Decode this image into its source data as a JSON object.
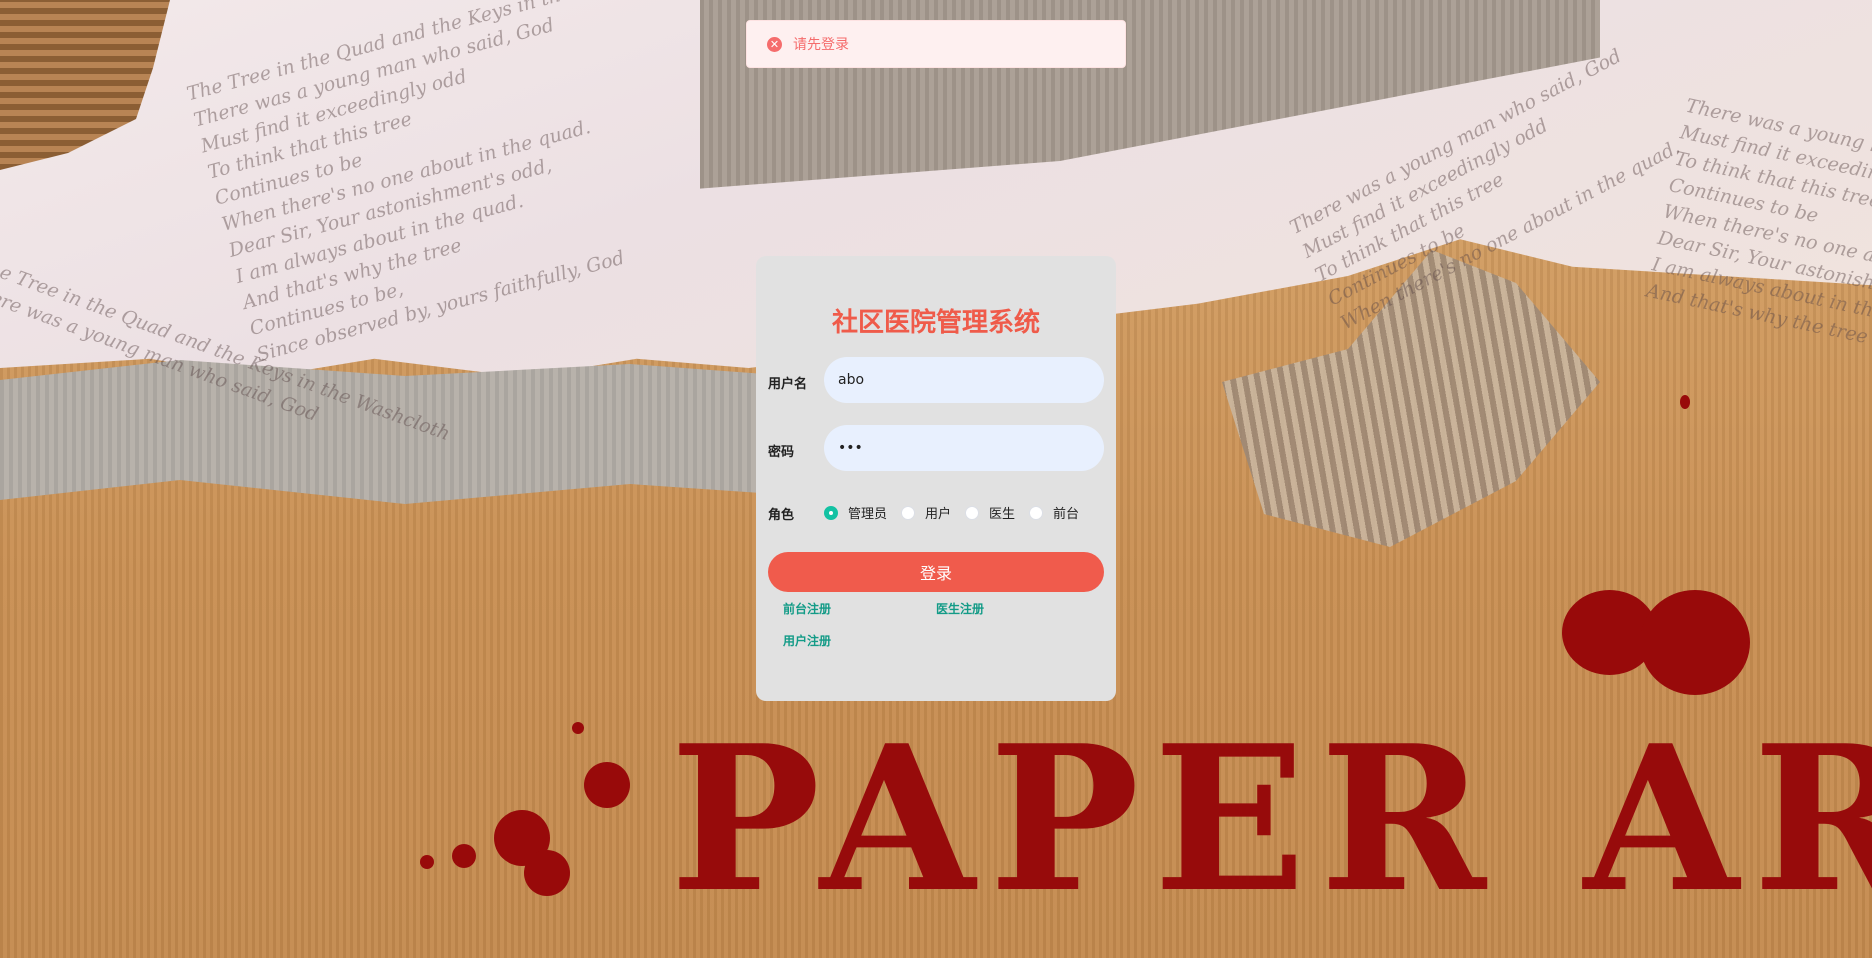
{
  "toast": {
    "icon": "error-circle-icon",
    "message": "请先登录"
  },
  "login": {
    "title": "社区医院管理系统",
    "username_label": "用户名",
    "username_value": "abo",
    "password_label": "密码",
    "password_value": "•••",
    "role_label": "角色",
    "roles": [
      {
        "label": "管理员",
        "selected": true
      },
      {
        "label": "用户",
        "selected": false
      },
      {
        "label": "医生",
        "selected": false
      },
      {
        "label": "前台",
        "selected": false
      }
    ],
    "submit_label": "登录",
    "links": {
      "front_register": "前台注册",
      "doctor_register": "医生注册",
      "user_register": "用户注册"
    }
  },
  "background": {
    "headline": "PAPER ART",
    "script_lines": [
      "The Tree in the Quad and the Keys in the Washcloth",
      "There was a young man who said, God",
      "Must find it exceedingly odd",
      "To think that this tree",
      "Continues to be",
      "When there's no one about in the quad.",
      "Dear Sir, Your astonishment's odd,",
      "I am always about in the quad.",
      "And that's why the tree",
      "Continues to be,",
      "Since observed by, yours faithfully, God"
    ]
  },
  "colors": {
    "accent": "#f05b4a",
    "link": "#139b87",
    "radio_on": "#13c2a3",
    "error": "#f56c6c"
  }
}
